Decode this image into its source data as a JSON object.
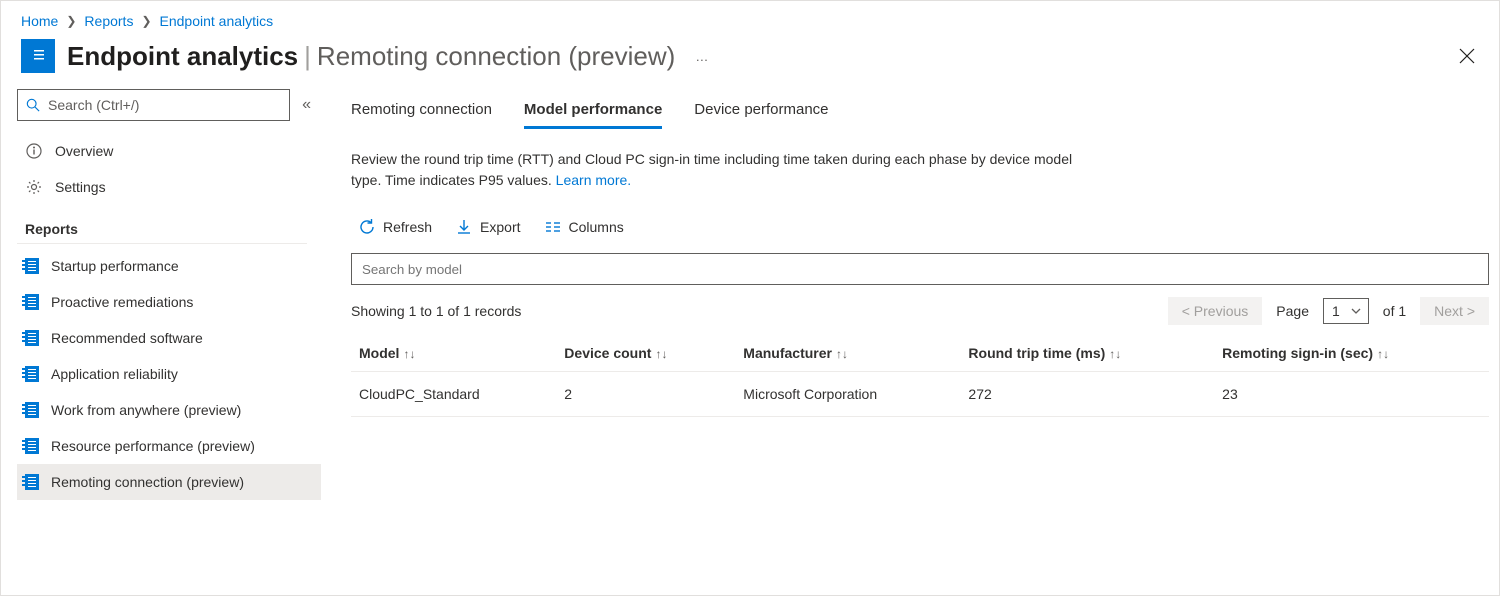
{
  "breadcrumb": {
    "items": [
      "Home",
      "Reports",
      "Endpoint analytics"
    ]
  },
  "header": {
    "title_main": "Endpoint analytics",
    "title_sub": "Remoting connection (preview)"
  },
  "sidebar": {
    "search_placeholder": "Search (Ctrl+/)",
    "overview": "Overview",
    "settings": "Settings",
    "section_label": "Reports",
    "reports": [
      {
        "label": "Startup performance"
      },
      {
        "label": "Proactive remediations"
      },
      {
        "label": "Recommended software"
      },
      {
        "label": "Application reliability"
      },
      {
        "label": "Work from anywhere (preview)"
      },
      {
        "label": "Resource performance (preview)"
      },
      {
        "label": "Remoting connection (preview)"
      }
    ]
  },
  "tabs": {
    "items": [
      "Remoting connection",
      "Model performance",
      "Device performance"
    ],
    "active_index": 1
  },
  "description": {
    "text": "Review the round trip time (RTT) and Cloud PC sign-in time including time taken during each phase by device model type. Time indicates P95 values. ",
    "link": "Learn more."
  },
  "toolbar": {
    "refresh": "Refresh",
    "export": "Export",
    "columns": "Columns"
  },
  "search": {
    "placeholder": "Search by model"
  },
  "pager": {
    "record_text": "Showing 1 to 1 of 1 records",
    "prev": "<  Previous",
    "page_label": "Page",
    "page_value": "1",
    "of_label": "of 1",
    "next": "Next  >"
  },
  "table": {
    "headers": [
      "Model",
      "Device count",
      "Manufacturer",
      "Round trip time (ms)",
      "Remoting sign-in (sec)"
    ],
    "rows": [
      {
        "model": "CloudPC_Standard",
        "device_count": "2",
        "manufacturer": "Microsoft Corporation",
        "rtt": "272",
        "signin": "23"
      }
    ]
  }
}
